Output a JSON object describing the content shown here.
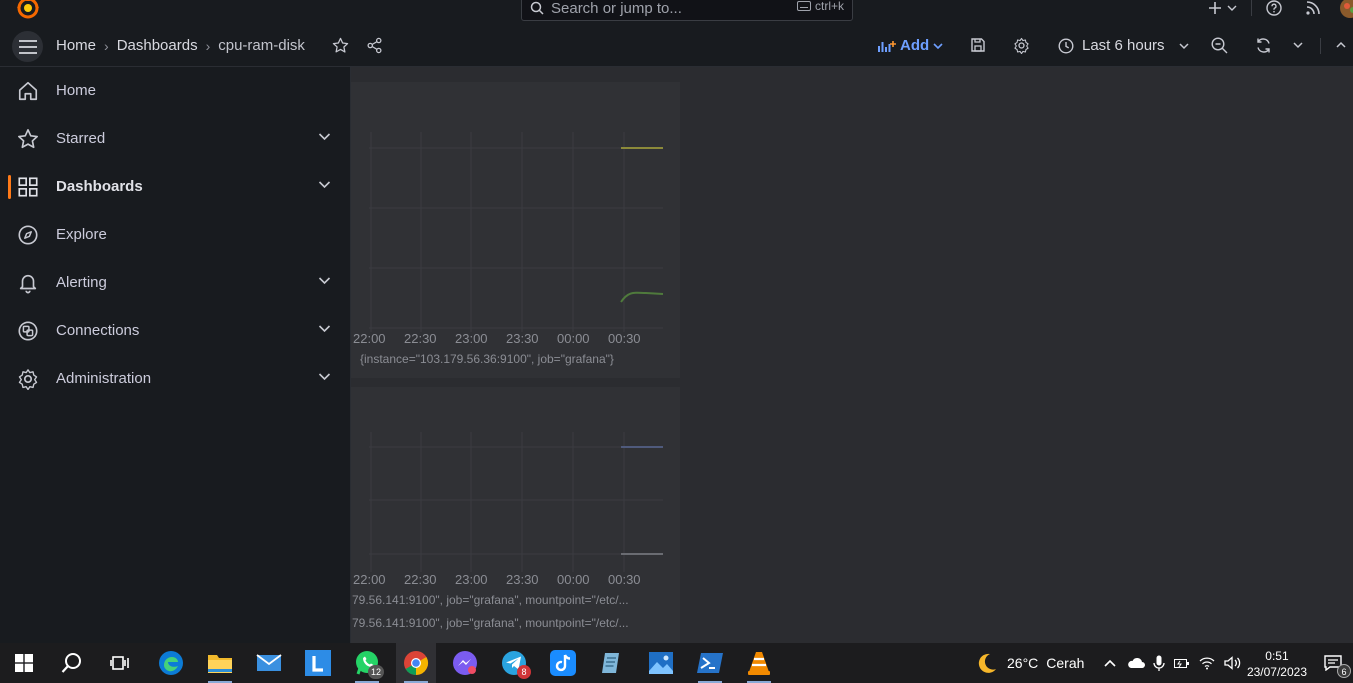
{
  "search": {
    "placeholder": "Search or jump to...",
    "shortcut": "ctrl+k"
  },
  "breadcrumb": {
    "home": "Home",
    "dashboards": "Dashboards",
    "current": "cpu-ram-disk"
  },
  "toolbar": {
    "add_label": "Add",
    "time_range": "Last 6 hours"
  },
  "sidebar": {
    "items": [
      {
        "label": "Home",
        "icon": "home-icon",
        "expandable": false,
        "active": false
      },
      {
        "label": "Starred",
        "icon": "star-icon",
        "expandable": true,
        "active": false
      },
      {
        "label": "Dashboards",
        "icon": "apps-icon",
        "expandable": true,
        "active": true
      },
      {
        "label": "Explore",
        "icon": "compass-icon",
        "expandable": false,
        "active": false
      },
      {
        "label": "Alerting",
        "icon": "bell-icon",
        "expandable": true,
        "active": false
      },
      {
        "label": "Connections",
        "icon": "connections-icon",
        "expandable": true,
        "active": false
      },
      {
        "label": "Administration",
        "icon": "cog-icon",
        "expandable": true,
        "active": false
      }
    ]
  },
  "panels": [
    {
      "x_ticks": [
        "22:00",
        "22:30",
        "23:00",
        "23:30",
        "00:00",
        "00:30"
      ],
      "legend": [
        "{instance=\"103.179.56.36:9100\", job=\"grafana\"}"
      ]
    },
    {
      "x_ticks": [
        "22:00",
        "22:30",
        "23:00",
        "23:30",
        "00:00",
        "00:30"
      ],
      "legend": [
        "79.56.141:9100\", job=\"grafana\", mountpoint=\"/etc/...",
        "79.56.141:9100\", job=\"grafana\", mountpoint=\"/etc/..."
      ]
    }
  ],
  "taskbar": {
    "badges": {
      "whatsapp": "12",
      "telegram": "8",
      "notifications": "6"
    },
    "weather": {
      "temp": "26°C",
      "desc": "Cerah"
    },
    "clock": {
      "time": "0:51",
      "date": "23/07/2023"
    }
  },
  "colors": {
    "accent_orange": "#ff7a18",
    "link_blue": "#6e9fff",
    "bg": "#181b1f"
  }
}
